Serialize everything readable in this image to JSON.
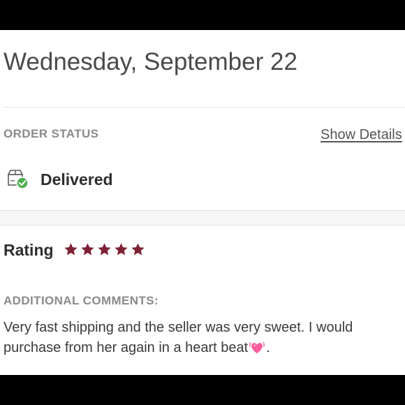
{
  "date_heading": "Wednesday, September 22",
  "order_status": {
    "label": "ORDER STATUS",
    "show_details_label": "Show Details",
    "status_text": "Delivered",
    "status_icon": "package-delivered-icon",
    "check_color": "#4caf50"
  },
  "rating": {
    "label": "Rating",
    "stars": 5,
    "max_stars": 5,
    "star_color": "#7d2235"
  },
  "comments": {
    "label": "ADDITIONAL COMMENTS:",
    "text_before": "Very fast shipping and the seller was very sweet. I would purchase from her again in a heart beat",
    "emoji": "beating-heart-icon",
    "text_after": "."
  },
  "colors": {
    "frame": "#000000",
    "background": "#ffffff",
    "heading_text": "#4a4a4a",
    "muted_label": "#8a8a8a"
  }
}
